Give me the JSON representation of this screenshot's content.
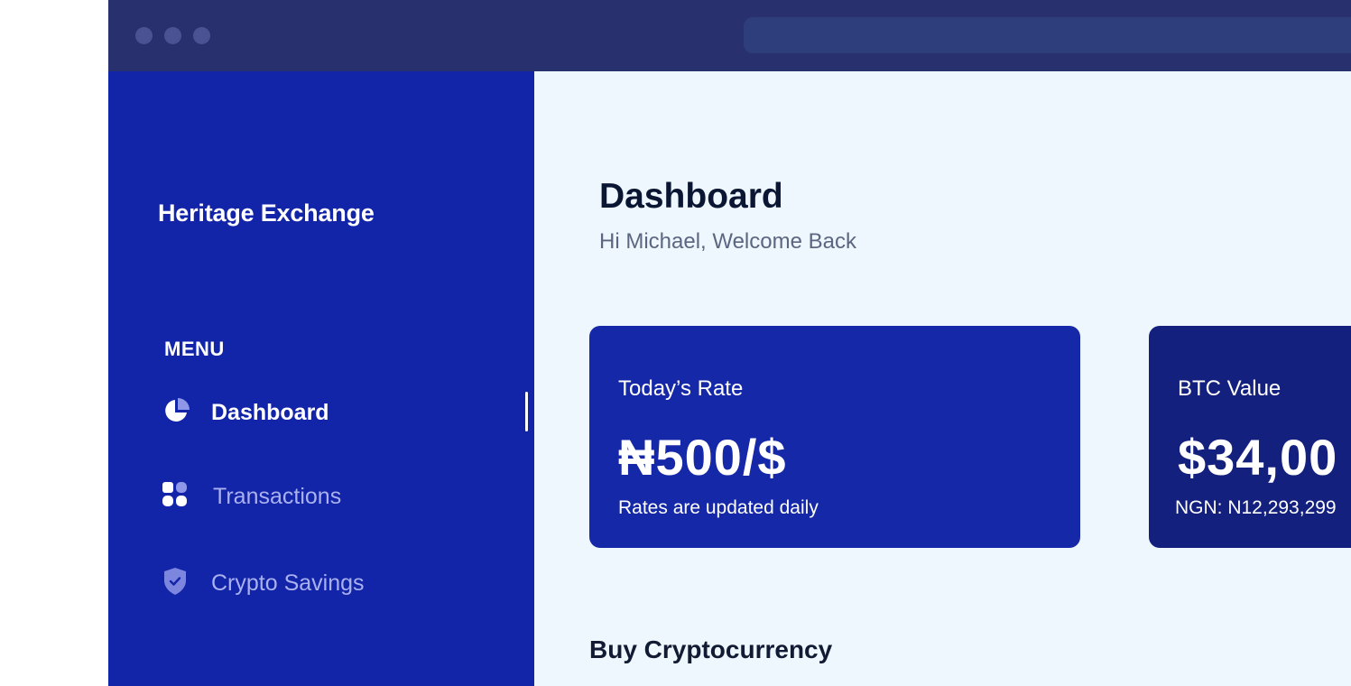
{
  "sidebar": {
    "brand": "Heritage Exchange",
    "menu_label": "MENU",
    "items": [
      {
        "label": "Dashboard",
        "icon": "pie-chart-icon",
        "active": true
      },
      {
        "label": "Transactions",
        "icon": "grid-icon",
        "active": false
      },
      {
        "label": "Crypto Savings",
        "icon": "shield-check-icon",
        "active": false
      }
    ]
  },
  "header": {
    "title": "Dashboard",
    "subtitle": "Hi Michael, Welcome Back"
  },
  "cards": [
    {
      "label": "Today’s Rate",
      "value": "₦500/$",
      "note": "Rates are updated daily"
    },
    {
      "label": "BTC Value",
      "value": "$34,00",
      "note": "NGN: N12,293,299"
    }
  ],
  "sections": {
    "buy_title": "Buy Cryptocurrency"
  },
  "colors": {
    "titlebar": "#28306e",
    "sidebar": "#1224a8",
    "main_bg": "#eef6fe",
    "card_rate": "#1428a8",
    "card_btc": "#14207e"
  }
}
